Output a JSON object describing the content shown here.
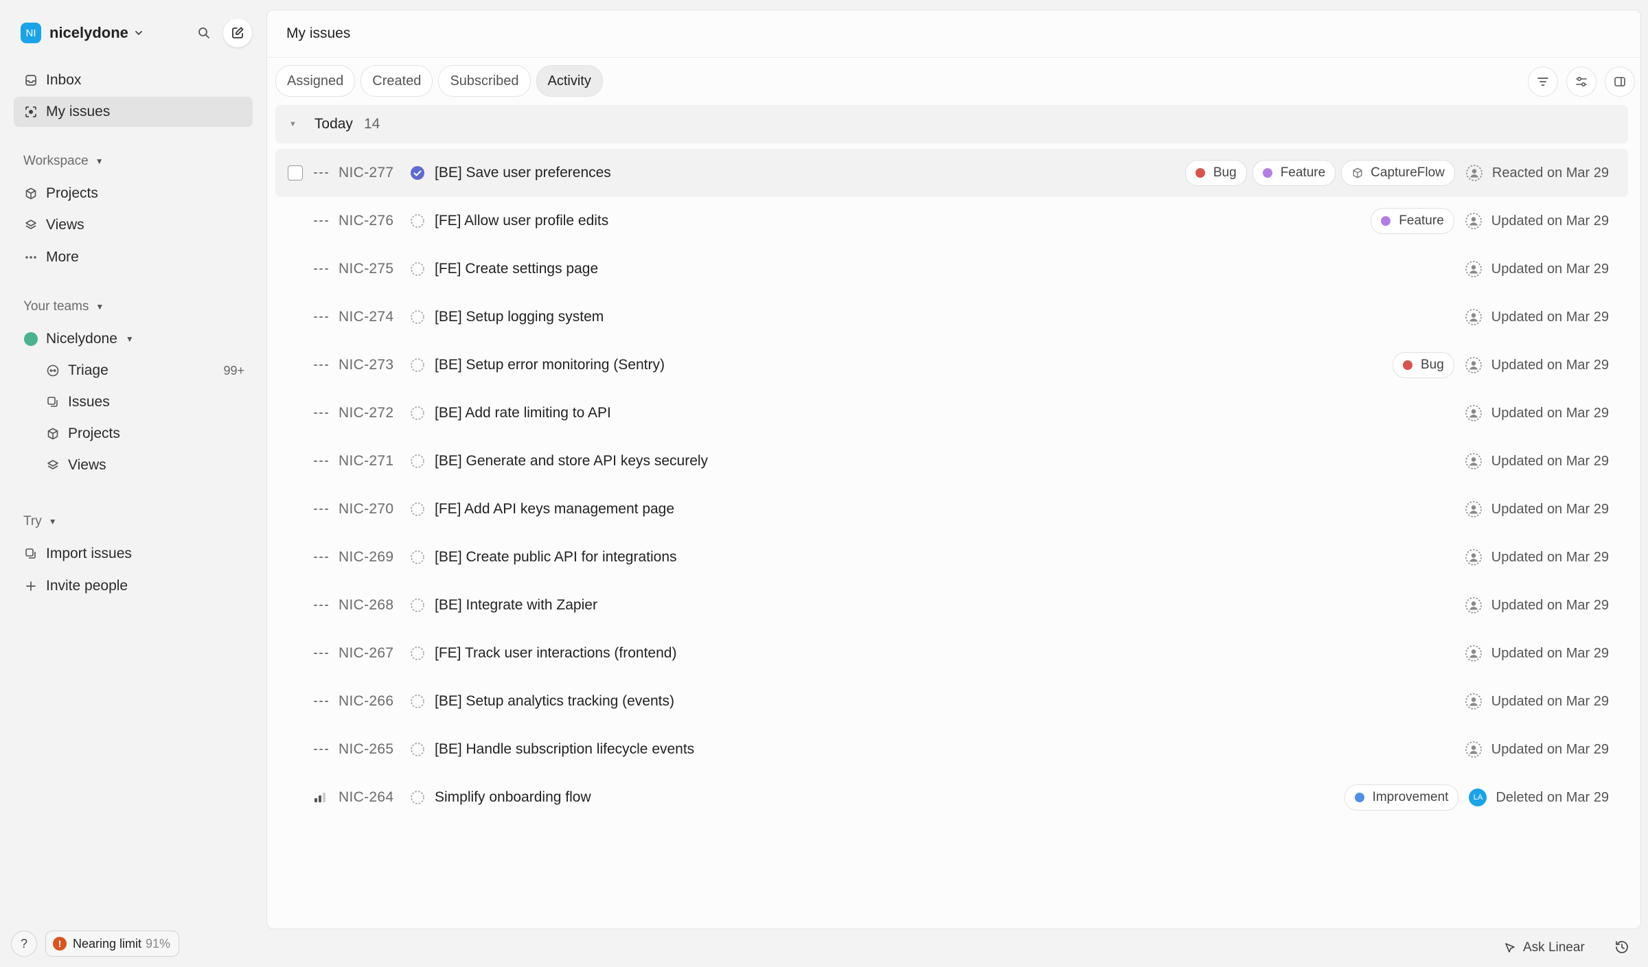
{
  "workspace": {
    "initials": "NI",
    "name": "nicelydone"
  },
  "nav": {
    "inbox": "Inbox",
    "my_issues": "My issues"
  },
  "workspace_section": {
    "title": "Workspace",
    "items": [
      "Projects",
      "Views",
      "More"
    ]
  },
  "teams_section": {
    "title": "Your teams",
    "team_name": "Nicelydone",
    "items": [
      {
        "label": "Triage",
        "count": "99+"
      },
      {
        "label": "Issues"
      },
      {
        "label": "Projects"
      },
      {
        "label": "Views"
      }
    ]
  },
  "try_section": {
    "title": "Try",
    "items": [
      "Import issues",
      "Invite people"
    ]
  },
  "footer": {
    "help": "?",
    "limit_label": "Nearing limit",
    "limit_percent": "91%",
    "ask": "Ask Linear"
  },
  "main": {
    "title": "My issues",
    "tabs": [
      "Assigned",
      "Created",
      "Subscribed",
      "Activity"
    ],
    "active_tab": "Activity",
    "group": {
      "label": "Today",
      "count": "14"
    }
  },
  "label_colors": {
    "Bug": "#d9534f",
    "Feature": "#b27ee6",
    "Improvement": "#4f8fe6"
  },
  "issues": [
    {
      "id": "NIC-277",
      "title": "[BE] Save user preferences",
      "status": "done",
      "priority": "none",
      "labels": [
        "Bug",
        "Feature"
      ],
      "project": "CaptureFlow",
      "assignee": "unassigned",
      "activity": "Reacted on Mar 29"
    },
    {
      "id": "NIC-276",
      "title": "[FE] Allow user profile edits",
      "status": "backlog",
      "priority": "none",
      "labels": [
        "Feature"
      ],
      "assignee": "unassigned",
      "activity": "Updated on Mar 29"
    },
    {
      "id": "NIC-275",
      "title": "[FE] Create settings page",
      "status": "backlog",
      "priority": "none",
      "labels": [],
      "assignee": "unassigned",
      "activity": "Updated on Mar 29"
    },
    {
      "id": "NIC-274",
      "title": "[BE] Setup logging system",
      "status": "backlog",
      "priority": "none",
      "labels": [],
      "assignee": "unassigned",
      "activity": "Updated on Mar 29"
    },
    {
      "id": "NIC-273",
      "title": "[BE] Setup error monitoring (Sentry)",
      "status": "backlog",
      "priority": "none",
      "labels": [
        "Bug"
      ],
      "assignee": "unassigned",
      "activity": "Updated on Mar 29"
    },
    {
      "id": "NIC-272",
      "title": "[BE] Add rate limiting to API",
      "status": "backlog",
      "priority": "none",
      "labels": [],
      "assignee": "unassigned",
      "activity": "Updated on Mar 29"
    },
    {
      "id": "NIC-271",
      "title": "[BE] Generate and store API keys securely",
      "status": "backlog",
      "priority": "none",
      "labels": [],
      "assignee": "unassigned",
      "activity": "Updated on Mar 29"
    },
    {
      "id": "NIC-270",
      "title": "[FE] Add API keys management page",
      "status": "backlog",
      "priority": "none",
      "labels": [],
      "assignee": "unassigned",
      "activity": "Updated on Mar 29"
    },
    {
      "id": "NIC-269",
      "title": "[BE] Create public API for integrations",
      "status": "backlog",
      "priority": "none",
      "labels": [],
      "assignee": "unassigned",
      "activity": "Updated on Mar 29"
    },
    {
      "id": "NIC-268",
      "title": "[BE] Integrate with Zapier",
      "status": "backlog",
      "priority": "none",
      "labels": [],
      "assignee": "unassigned",
      "activity": "Updated on Mar 29"
    },
    {
      "id": "NIC-267",
      "title": "[FE] Track user interactions (frontend)",
      "status": "backlog",
      "priority": "none",
      "labels": [],
      "assignee": "unassigned",
      "activity": "Updated on Mar 29"
    },
    {
      "id": "NIC-266",
      "title": "[BE] Setup analytics tracking (events)",
      "status": "backlog",
      "priority": "none",
      "labels": [],
      "assignee": "unassigned",
      "activity": "Updated on Mar 29"
    },
    {
      "id": "NIC-265",
      "title": "[BE] Handle subscription lifecycle events",
      "status": "backlog",
      "priority": "none",
      "labels": [],
      "assignee": "unassigned",
      "activity": "Updated on Mar 29"
    },
    {
      "id": "NIC-264",
      "title": "Simplify onboarding flow",
      "status": "backlog",
      "priority": "medium",
      "labels": [
        "Improvement"
      ],
      "assignee": "LA",
      "activity": "Deleted on Mar 29"
    }
  ]
}
